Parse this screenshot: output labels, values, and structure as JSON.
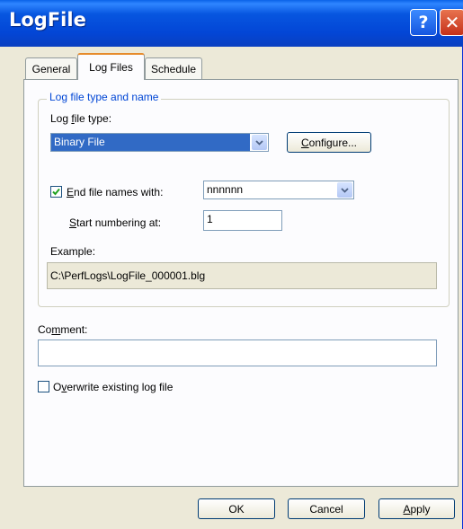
{
  "window": {
    "title": "LogFile",
    "help_glyph": "?",
    "close_glyph": "✕"
  },
  "tabs": [
    {
      "label": "General"
    },
    {
      "label": "Log Files"
    },
    {
      "label": "Schedule"
    }
  ],
  "group": {
    "legend": "Log file type and name"
  },
  "log_file_type": {
    "label_pre": "Log ",
    "label_ul": "f",
    "label_post": "ile type:",
    "selected": "Binary File",
    "configure_ul": "C",
    "configure_rest": "onfigure..."
  },
  "end_file_names": {
    "checked_glyph": "✓",
    "label_ul": "E",
    "label_rest": "nd file names with:",
    "selected": "nnnnnn"
  },
  "start_numbering": {
    "label_ul": "S",
    "label_rest": "tart numbering at:",
    "value": "1"
  },
  "example": {
    "label": "Example:",
    "value": "C:\\PerfLogs\\LogFile_000001.blg"
  },
  "comment": {
    "label_pre": "Co",
    "label_ul": "m",
    "label_post": "ment:",
    "value": ""
  },
  "overwrite": {
    "label_pre": "O",
    "label_ul": "v",
    "label_post": "erwrite existing log file"
  },
  "buttons": {
    "ok": "OK",
    "cancel": "Cancel",
    "apply_ul": "A",
    "apply_rest": "pply"
  },
  "colors": {
    "titlebar": "#0346d6",
    "legend": "#0046d5",
    "selection": "#316ac5",
    "checkmark": "#21a121"
  }
}
